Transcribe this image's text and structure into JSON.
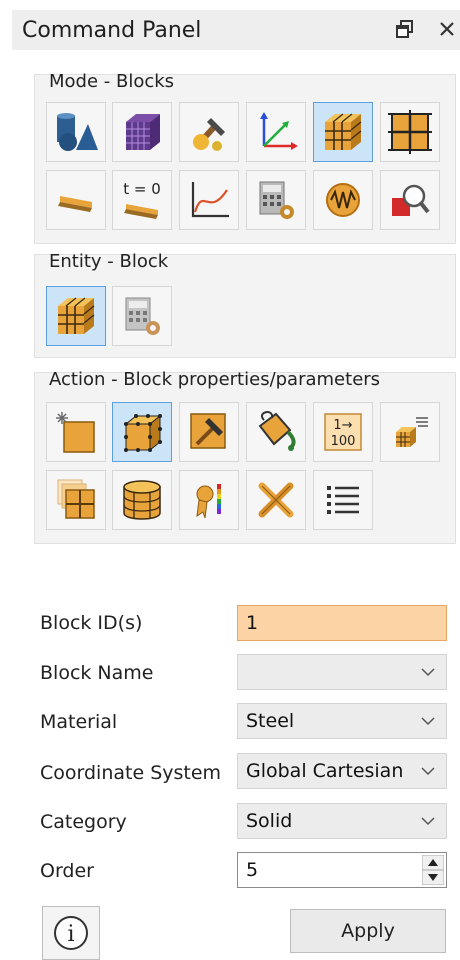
{
  "window": {
    "title": "Command Panel",
    "float_icon": "▣",
    "close_icon": "✕"
  },
  "mode_group": {
    "label": "Mode - Blocks",
    "buttons": [
      {
        "icon": "geometry-icon",
        "active": false
      },
      {
        "icon": "mesh-icon",
        "active": false
      },
      {
        "icon": "tools-icon",
        "active": false
      },
      {
        "icon": "axes-icon",
        "active": false
      },
      {
        "icon": "blocks-icon",
        "active": true
      },
      {
        "icon": "grid-nodes-icon",
        "active": false
      },
      {
        "icon": "plank-icon",
        "active": false
      },
      {
        "icon": "time-plank-icon",
        "active": false,
        "label": "t = 0"
      },
      {
        "icon": "curve-plot-icon",
        "active": false
      },
      {
        "icon": "calculator-gear-icon",
        "active": false
      },
      {
        "icon": "wave-circle-icon",
        "active": false
      },
      {
        "icon": "magnify-icon",
        "active": false
      }
    ]
  },
  "entity_group": {
    "label": "Entity - Block",
    "buttons": [
      {
        "icon": "blocks-icon",
        "active": true
      },
      {
        "icon": "calculator-gear-icon",
        "active": false
      }
    ]
  },
  "action_group": {
    "label": "Action - Block properties/parameters",
    "buttons": [
      {
        "icon": "new-block-icon",
        "active": false
      },
      {
        "icon": "block-nodes-icon",
        "active": true
      },
      {
        "icon": "hammer-icon",
        "active": false
      },
      {
        "icon": "paint-bucket-icon",
        "active": false
      },
      {
        "icon": "renumber-icon",
        "active": false,
        "label_top": "1→",
        "label_bottom": "100"
      },
      {
        "icon": "block-list-icon",
        "active": false
      },
      {
        "icon": "split-square-icon",
        "active": false
      },
      {
        "icon": "cylinder-grid-icon",
        "active": false
      },
      {
        "icon": "ribbon-colorbar-icon",
        "active": false
      },
      {
        "icon": "cross-tools-icon",
        "active": false
      },
      {
        "icon": "list-icon",
        "active": false
      }
    ]
  },
  "form": {
    "block_ids_label": "Block ID(s)",
    "block_ids_value": "1",
    "block_name_label": "Block Name",
    "block_name_value": "",
    "material_label": "Material",
    "material_value": "Steel",
    "coord_label": "Coordinate System",
    "coord_value": "Global Cartesian",
    "category_label": "Category",
    "category_value": "Solid",
    "order_label": "Order",
    "order_value": "5"
  },
  "footer": {
    "info_icon": "i",
    "apply_label": "Apply"
  },
  "colors": {
    "active_bg": "#cce4f7",
    "active_border": "#5c9fdc",
    "highlight_field": "#fcd3a4",
    "orange": "#e8a33a"
  }
}
